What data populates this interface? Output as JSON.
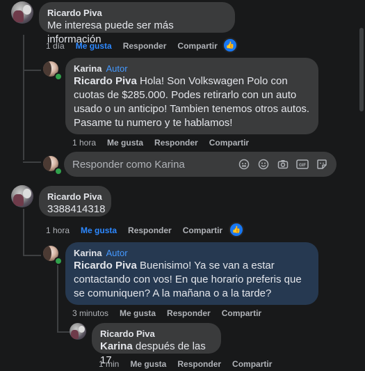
{
  "comments": [
    {
      "author": "Ricardo Piva",
      "text": "Me interesa puede ser más información",
      "time": "1 día",
      "like": "Me gusta",
      "reply": "Responder",
      "share": "Compartir"
    },
    {
      "author": "Karina",
      "badge": "Autor",
      "mention": "Ricardo Piva",
      "text": " Hola! Son Volkswagen Polo con cuotas de $285.000. Podes retirarlo con un auto usado o un anticipo! Tambien tenemos otros autos. Pasame tu numero y te hablamos!",
      "time": "1 hora",
      "like": "Me gusta",
      "reply": "Responder",
      "share": "Compartir"
    },
    {
      "author": "Ricardo Piva",
      "text": "3388414318",
      "time": "1 hora",
      "like": "Me gusta",
      "reply": "Responder",
      "share": "Compartir"
    },
    {
      "author": "Karina",
      "badge": "Autor",
      "mention": "Ricardo Piva",
      "text": " Buenisimo! Ya se van a estar contactando con vos! En que horario preferis que se comuniquen? A la mañana o a la tarde?",
      "time": "3 minutos",
      "like": "Me gusta",
      "reply": "Responder",
      "share": "Compartir"
    },
    {
      "author": "Ricardo Piva",
      "mention": "Karina",
      "text": " después de las 17",
      "time": "1 min",
      "like": "Me gusta",
      "reply": "Responder",
      "share": "Compartir"
    }
  ],
  "reply_box": {
    "placeholder": "Responder como Karina",
    "icons": [
      "emoji-avatar-icon",
      "smiley-icon",
      "camera-icon",
      "gif-icon",
      "sticker-icon"
    ],
    "gif_label": "GIF"
  },
  "colors": {
    "background": "#18191a",
    "bubble": "#3a3b3c",
    "bubble_highlight": "#263951",
    "link_blue": "#2d88ff",
    "author_badge": "#4599ff"
  }
}
